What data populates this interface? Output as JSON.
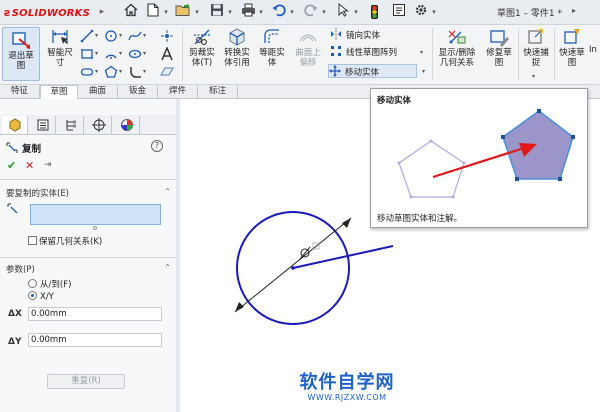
{
  "app": {
    "brand": "SOLIDWORKS",
    "document_title": "草图1 – 零件1 *"
  },
  "quick_access": {
    "icons": [
      "home-icon",
      "new-document-icon",
      "open-folder-icon",
      "save-icon",
      "print-icon",
      "undo-icon",
      "redo-icon",
      "select-arrow-icon",
      "rebuild-traffic-light-icon",
      "file-properties-icon",
      "options-gear-icon"
    ]
  },
  "ribbon": {
    "exit_sketch": {
      "label": "退出草\n图",
      "sub": "▾"
    },
    "smart_dimension": {
      "label": "智能尺\n寸"
    },
    "trim": {
      "label": "剪裁实\n体(T)"
    },
    "convert": {
      "label": "转换实\n体引用"
    },
    "offset": {
      "label": "等距实\n体"
    },
    "offset_surface": {
      "label": "曲面上\n偏移"
    },
    "mirror": {
      "label": "镜向实体"
    },
    "linear_pattern": {
      "label": "线性草图阵列"
    },
    "move": {
      "label": "移动实体"
    },
    "display_relations": {
      "label": "显示/删除\n几何关系"
    },
    "repair": {
      "label": "修复草\n图"
    },
    "quick_snap": {
      "label": "快速捕\n捉"
    },
    "rapid_sketch": {
      "label": "快速草\n图"
    },
    "more": {
      "label": "In"
    }
  },
  "tabs": [
    "特征",
    "草图",
    "曲面",
    "钣金",
    "焊件",
    "标注"
  ],
  "active_tab": "草图",
  "property_manager": {
    "title": "复制",
    "ok": "✔",
    "cancel": "✕",
    "pin": "⇥",
    "help": "?",
    "entities_group": {
      "title": "要复制的实体(E)",
      "caret": "⌃"
    },
    "keep_relations": {
      "label": "保留几何关系(K)",
      "checked": false
    },
    "params_group": {
      "title": "参数(P)",
      "caret": "⌃"
    },
    "from_to": {
      "label": "从/到(F)",
      "selected": false
    },
    "xy": {
      "label": "X/Y",
      "selected": true
    },
    "dx": {
      "axis": "ΔX",
      "value": "0.00mm"
    },
    "dy": {
      "axis": "ΔY",
      "value": "0.00mm"
    },
    "repeat": {
      "label": "重复(R)"
    }
  },
  "tooltip": {
    "title": "移动实体",
    "description": "移动草图实体和注解。"
  },
  "watermark": {
    "text": "软件自学网",
    "url": "WWW.RJZXW.COM"
  },
  "colors": {
    "accent": "#1f62c7",
    "circle": "#1a1ab8",
    "pentagon_fill": "#9b95c9",
    "arrow": "#e01818"
  }
}
